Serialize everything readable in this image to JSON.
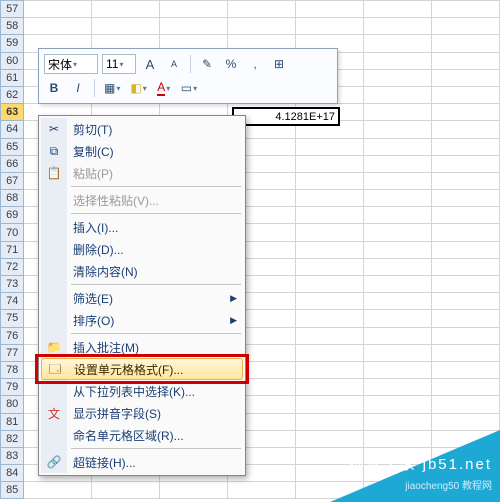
{
  "rows": [
    "57",
    "58",
    "59",
    "60",
    "61",
    "62",
    "63",
    "64",
    "65",
    "66",
    "67",
    "68",
    "69",
    "70",
    "71",
    "72",
    "73",
    "74",
    "75",
    "76",
    "77",
    "78",
    "79",
    "80",
    "81",
    "82",
    "83",
    "84",
    "85"
  ],
  "selected_row": "63",
  "cell_value": "4.1281E+17",
  "mini_toolbar": {
    "font_name": "宋体",
    "font_size": "11",
    "btn_grow": "A",
    "btn_shrink": "A",
    "btn_paint": "✎",
    "btn_percent": "%",
    "btn_comma": ",",
    "btn_dec": "⊞",
    "btn_bold": "B",
    "btn_italic": "I",
    "btn_border": "▦",
    "btn_fill": "◧",
    "btn_fontcolor": "A",
    "btn_merge": "▭"
  },
  "menu": {
    "cut": "剪切(T)",
    "copy": "复制(C)",
    "paste": "粘贴(P)",
    "paste_special": "选择性粘贴(V)...",
    "insert": "插入(I)...",
    "delete": "删除(D)...",
    "clear": "清除内容(N)",
    "filter": "筛选(E)",
    "sort": "排序(O)",
    "comment": "插入批注(M)",
    "format_cells": "设置单元格格式(F)...",
    "pick_list": "从下拉列表中选择(K)...",
    "phonetic": "显示拼音字段(S)",
    "name_range": "命名单元格区域(R)...",
    "hyperlink": "超链接(H)..."
  },
  "watermark": {
    "line1": "脚本之家 jb51.net",
    "line2": "jiaocheng50 教程网"
  }
}
